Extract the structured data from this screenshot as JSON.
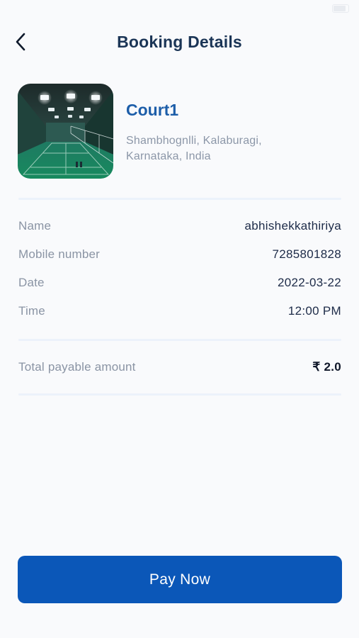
{
  "header": {
    "title": "Booking Details",
    "back_icon": "chevron-left-icon"
  },
  "court": {
    "name": "Court1",
    "address": "Shambhognlli, Kalaburagi, Karnataka, India",
    "image": "badminton-court-photo"
  },
  "details": [
    {
      "label": "Name",
      "value": "abhishekkathiriya"
    },
    {
      "label": "Mobile number",
      "value": "7285801828"
    },
    {
      "label": "Date",
      "value": "2022-03-22"
    },
    {
      "label": "Time",
      "value": "12:00 PM"
    }
  ],
  "total": {
    "label": "Total payable amount",
    "value": "₹ 2.0"
  },
  "pay_button": {
    "label": "Pay Now"
  },
  "colors": {
    "primary": "#0b57b8",
    "court_name": "#1d5ea9",
    "title": "#1b3556",
    "label": "#8a94a4",
    "background": "#f9fafc"
  }
}
